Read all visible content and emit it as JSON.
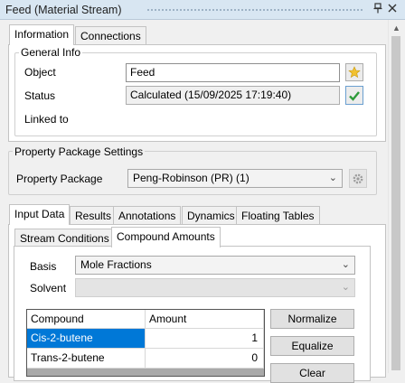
{
  "window": {
    "title": "Feed (Material Stream)",
    "pin_icon": "pin-icon",
    "close_icon": "close-icon"
  },
  "top_tabs": [
    {
      "label": "Information",
      "active": true
    },
    {
      "label": "Connections",
      "active": false
    }
  ],
  "general_info": {
    "legend": "General Info",
    "object_label": "Object",
    "object_value": "Feed",
    "status_label": "Status",
    "status_value": "Calculated (15/09/2025 17:19:40)",
    "linked_label": "Linked to"
  },
  "property_package": {
    "legend": "Property Package Settings",
    "label": "Property Package",
    "selected": "Peng-Robinson (PR) (1)"
  },
  "data_tabs": [
    {
      "label": "Input Data",
      "active": true
    },
    {
      "label": "Results",
      "active": false
    },
    {
      "label": "Annotations",
      "active": false
    },
    {
      "label": "Dynamics",
      "active": false
    },
    {
      "label": "Floating Tables",
      "active": false
    }
  ],
  "sub_tabs": [
    {
      "label": "Stream Conditions",
      "active": false
    },
    {
      "label": "Compound Amounts",
      "active": true
    }
  ],
  "compound_amounts": {
    "basis_label": "Basis",
    "basis_value": "Mole Fractions",
    "solvent_label": "Solvent",
    "solvent_value": "",
    "columns": [
      "Compound",
      "Amount"
    ],
    "rows": [
      {
        "compound": "Cis-2-butene",
        "amount": "1",
        "selected": true
      },
      {
        "compound": "Trans-2-butene",
        "amount": "0",
        "selected": false
      }
    ],
    "buttons": {
      "normalize": "Normalize",
      "equalize": "Equalize",
      "clear": "Clear"
    }
  },
  "colors": {
    "titlebar": "#d8e6f2",
    "selection": "#0078d7",
    "check_green": "#2e9b3a",
    "star_yellow": "#f2c230"
  }
}
